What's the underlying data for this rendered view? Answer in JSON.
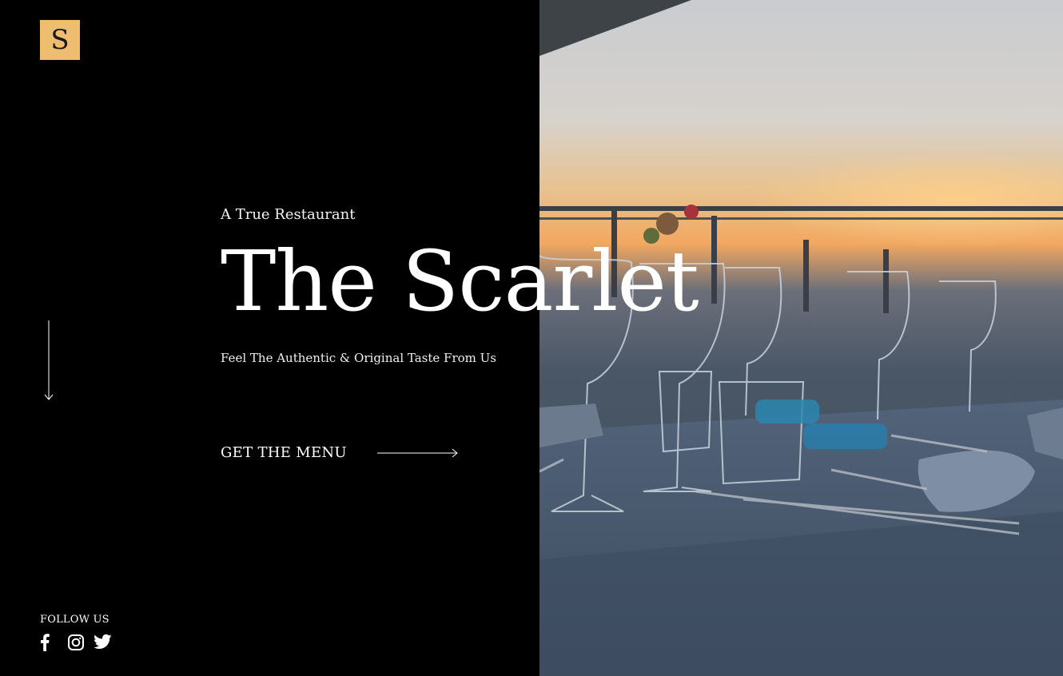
{
  "brand": {
    "logo_letter": "S"
  },
  "hero": {
    "eyebrow": "A True Restaurant",
    "title": "The Scarlet",
    "tagline": "Feel The Authentic & Original Taste From Us"
  },
  "cta": {
    "label": "GET THE MENU"
  },
  "social": {
    "label": "FOLLOW US",
    "icons": [
      "facebook-icon",
      "instagram-icon",
      "twitter-icon"
    ]
  },
  "colors": {
    "background": "#000000",
    "logo_bg": "#efbd70",
    "text": "#ffffff"
  }
}
